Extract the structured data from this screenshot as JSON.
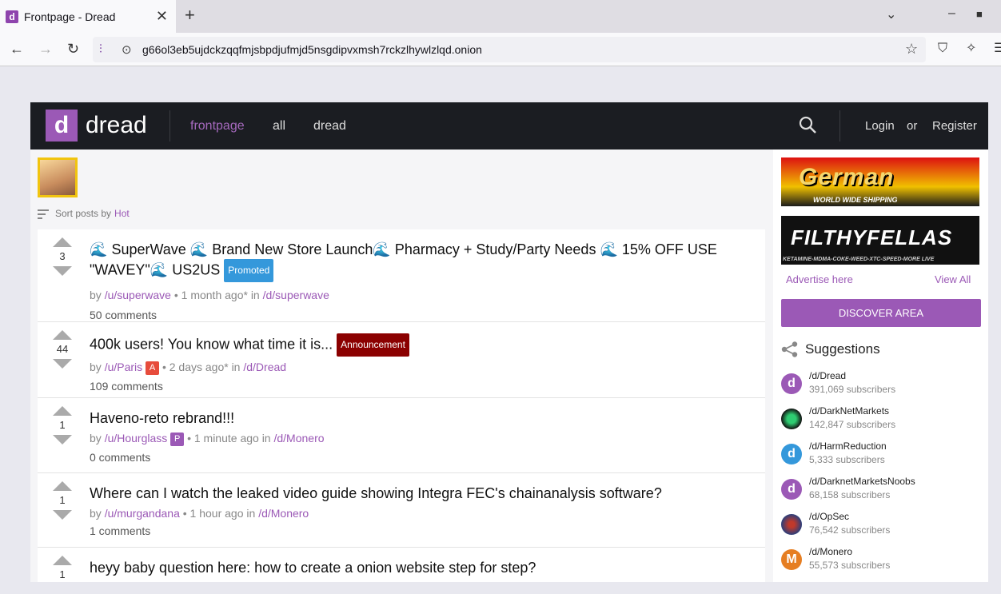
{
  "browser": {
    "tab_title": "Frontpage - Dread",
    "favicon": "d",
    "url": "g66ol3eb5ujdckzqqfmjsbpdjufmjd5nsgdipvxmsh7rckzlhywlzlqd.onion"
  },
  "header": {
    "logo_letter": "d",
    "logo_text": "dread",
    "nav": [
      "frontpage",
      "all",
      "dread"
    ],
    "login": "Login",
    "or": "or",
    "register": "Register"
  },
  "sort": {
    "label": "Sort posts by",
    "value": "Hot"
  },
  "posts": [
    {
      "score": "3",
      "title_parts": [
        "SuperWave",
        "Brand New Store Launch",
        "Pharmacy + Study/Party Needs",
        "15% OFF USE \"WAVEY\"",
        "US2US"
      ],
      "badge": "Promoted",
      "badge_color": "#3498db",
      "by": "by",
      "author": "/u/superwave",
      "time": "• 1 month ago* in",
      "sub": "/d/superwave",
      "comments": "50 comments"
    },
    {
      "score": "44",
      "title": "400k users! You know what time it is...",
      "badge": "Announcement",
      "badge_color": "#8b0000",
      "by": "by",
      "author": "/u/Paris",
      "user_badge": "A",
      "user_badge_color": "#e74c3c",
      "time": "• 2 days ago* in",
      "sub": "/d/Dread",
      "comments": "109 comments"
    },
    {
      "score": "1",
      "title": "Haveno-reto rebrand!!!",
      "by": "by",
      "author": "/u/Hourglass",
      "user_badge": "P",
      "user_badge_color": "#9b59b6",
      "time": "• 1 minute ago in",
      "sub": "/d/Monero",
      "comments": "0 comments"
    },
    {
      "score": "1",
      "title": "Where can I watch the leaked video guide showing Integra FEC's chainanalysis software?",
      "by": "by",
      "author": "/u/murgandana",
      "time": "• 1 hour ago in",
      "sub": "/d/Monero",
      "comments": "1 comments"
    },
    {
      "score": "1",
      "title": "heyy baby question here: how to create a onion website step for step?"
    }
  ],
  "sidebar": {
    "banner1_text": "German",
    "banner1_sub": "WORLD WIDE SHIPPING",
    "banner2_text": "FILTHYFELLAS",
    "banner2_sub": "KETAMINE-MDMA-COKE-WEED-XTC-SPEED-MORE   LIVE",
    "advertise": "Advertise here",
    "view_all": "View All",
    "discover": "DISCOVER AREA",
    "suggestions_title": "Suggestions",
    "suggestions": [
      {
        "name": "/d/Dread",
        "subs": "391,069 subscribers",
        "color": "#9b59b6",
        "glyph": "d"
      },
      {
        "name": "/d/DarkNetMarkets",
        "subs": "142,847 subscribers",
        "color": "#1e8449",
        "glyph": ""
      },
      {
        "name": "/d/HarmReduction",
        "subs": "5,333 subscribers",
        "color": "#3498db",
        "glyph": "d"
      },
      {
        "name": "/d/DarknetMarketsNoobs",
        "subs": "68,158 subscribers",
        "color": "#9b59b6",
        "glyph": "d"
      },
      {
        "name": "/d/OpSec",
        "subs": "76,542 subscribers",
        "color": "#2c3e7a",
        "glyph": ""
      },
      {
        "name": "/d/Monero",
        "subs": "55,573 subscribers",
        "color": "#e67e22",
        "glyph": "M"
      }
    ]
  }
}
